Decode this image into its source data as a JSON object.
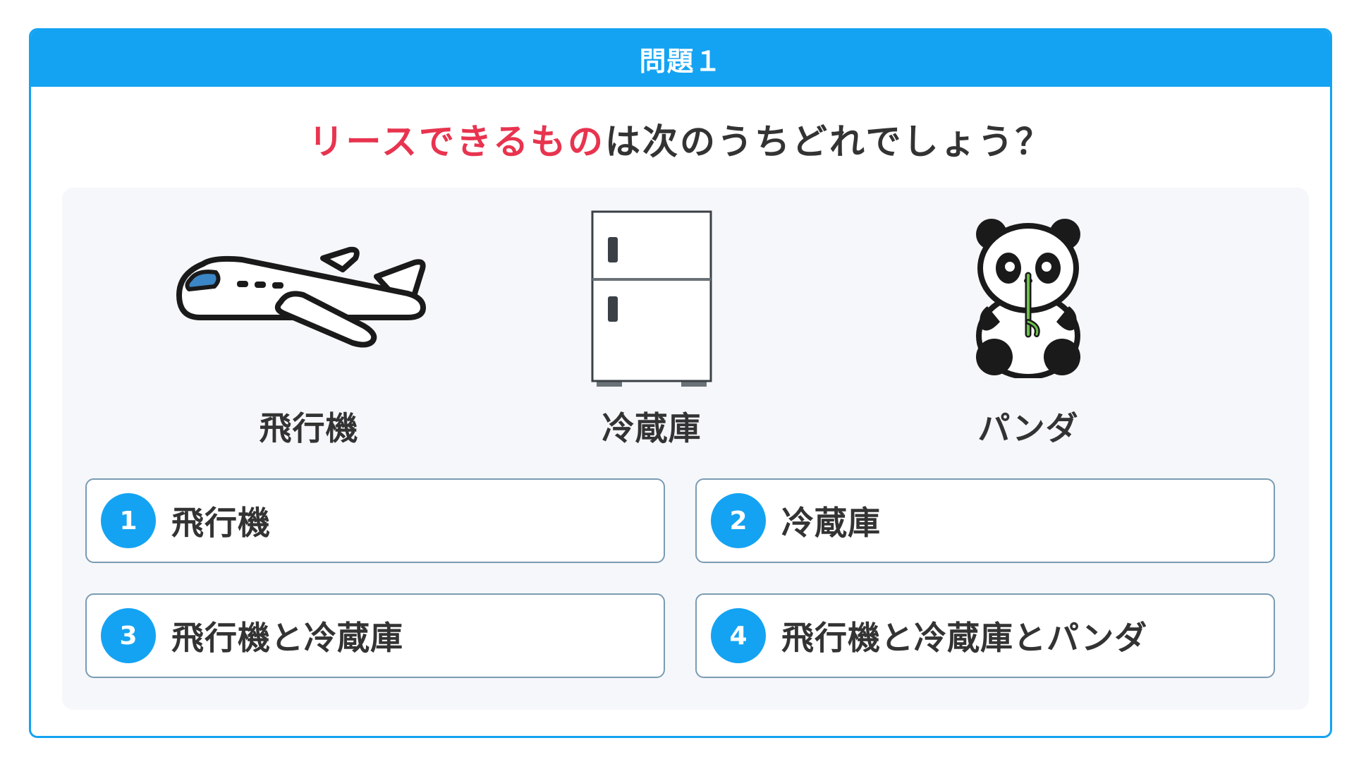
{
  "header": {
    "title": "問題１"
  },
  "question": {
    "highlight": "リースできるもの",
    "rest": "は次のうちどれでしょう？"
  },
  "items": [
    {
      "label": "飛行機",
      "icon": "airplane-icon"
    },
    {
      "label": "冷蔵庫",
      "icon": "refrigerator-icon"
    },
    {
      "label": "パンダ",
      "icon": "panda-icon"
    }
  ],
  "choices": [
    {
      "number": "1",
      "text": "飛行機"
    },
    {
      "number": "2",
      "text": "冷蔵庫"
    },
    {
      "number": "3",
      "text": "飛行機と冷蔵庫"
    },
    {
      "number": "4",
      "text": "飛行機と冷蔵庫とパンダ"
    }
  ],
  "colors": {
    "accent": "#14a3f2",
    "highlight": "#e8344f",
    "panel": "#f5f7fa",
    "text": "#333333"
  }
}
